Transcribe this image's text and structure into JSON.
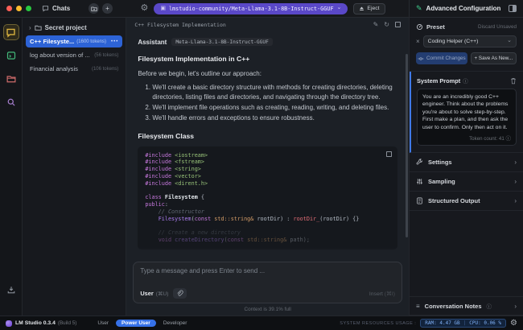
{
  "icons": {
    "gear": "⚙",
    "chevron_down": "⌄",
    "chevron_right": "›",
    "close": "×",
    "plus": "+",
    "dots": "•••",
    "info": "ⓘ",
    "pencil": "✎",
    "regen": "↻",
    "chip": "▣",
    "notes": "≡"
  },
  "topbar": {
    "model_pill": "lmstudio-community/Meta-Llama-3.1-8B-Instruct-GGUF",
    "eject_label": "Eject"
  },
  "sidebar": {
    "title": "Chats",
    "folder_label": "Secret project",
    "chats": [
      {
        "title": "C++ Filesyste...",
        "tokens": "(1600 tokens)"
      },
      {
        "title": "log about version of ...",
        "tokens": "(56 tokens)"
      },
      {
        "title": "Financial analysis",
        "tokens": "(106 tokens)"
      }
    ]
  },
  "chat": {
    "title": "C++ Filesystem Implementation",
    "message": {
      "role": "Assistant",
      "model_badge": "Meta-Llama-3.1-8B-Instruct-GGUF",
      "heading_main": "Filesystem Implementation in C++",
      "intro": "Before we begin, let's outline our approach:",
      "list": [
        "We'll create a basic directory structure with methods for creating directories, deleting directories, listing files and directories, and navigating through the directory tree.",
        "We'll implement file operations such as creating, reading, writing, and deleting files.",
        "We'll handle errors and exceptions to ensure robustness."
      ],
      "heading_code": "Filesystem Class",
      "code": {
        "lines": [
          {
            "segments": [
              {
                "t": "#include ",
                "c": "kw"
              },
              {
                "t": "<iostream>",
                "c": "str"
              }
            ]
          },
          {
            "segments": [
              {
                "t": "#include ",
                "c": "kw"
              },
              {
                "t": "<fstream>",
                "c": "str"
              }
            ]
          },
          {
            "segments": [
              {
                "t": "#include ",
                "c": "kw"
              },
              {
                "t": "<string>",
                "c": "str"
              }
            ]
          },
          {
            "segments": [
              {
                "t": "#include ",
                "c": "kw"
              },
              {
                "t": "<vector>",
                "c": "str"
              }
            ]
          },
          {
            "segments": [
              {
                "t": "#include ",
                "c": "kw"
              },
              {
                "t": "<dirent.h>",
                "c": "str"
              }
            ]
          },
          {
            "segments": []
          },
          {
            "segments": [
              {
                "t": "class ",
                "c": "kw"
              },
              {
                "t": "Filesystem",
                "c": "fnb"
              },
              {
                "t": " {",
                "c": "pl"
              }
            ]
          },
          {
            "segments": [
              {
                "t": "public",
                "c": "kw"
              },
              {
                "t": ":",
                "c": "pl"
              }
            ]
          },
          {
            "segments": [
              {
                "t": "    ",
                "c": "pl"
              },
              {
                "t": "// Constructor",
                "c": "cm"
              }
            ]
          },
          {
            "segments": [
              {
                "t": "    ",
                "c": "pl"
              },
              {
                "t": "Filesystem",
                "c": "pu"
              },
              {
                "t": "(",
                "c": "pl"
              },
              {
                "t": "const",
                "c": "kw"
              },
              {
                "t": " std::string&",
                "c": "ty"
              },
              {
                "t": " rootDir) : ",
                "c": "pl"
              },
              {
                "t": "rootDir_",
                "c": "va"
              },
              {
                "t": "(rootDir) {}",
                "c": "pl"
              }
            ]
          },
          {
            "segments": []
          },
          {
            "faded": true,
            "segments": [
              {
                "t": "    ",
                "c": "pl"
              },
              {
                "t": "// Create a new directory",
                "c": "cm"
              }
            ]
          },
          {
            "faded": true,
            "segments": [
              {
                "t": "    ",
                "c": "pl"
              },
              {
                "t": "void ",
                "c": "kw"
              },
              {
                "t": "createDirectory",
                "c": "pu"
              },
              {
                "t": "(",
                "c": "pl"
              },
              {
                "t": "const",
                "c": "kw"
              },
              {
                "t": " std::string&",
                "c": "ty"
              },
              {
                "t": " path);",
                "c": "pl"
              }
            ]
          }
        ]
      }
    },
    "input": {
      "placeholder": "Type a message and press Enter to send ...",
      "role_label": "User",
      "role_shortcut": "(⌘U)",
      "insert_label": "Insert",
      "insert_shortcut": "(⌘I)"
    },
    "context_status": "Context is 39.1% full"
  },
  "right_panel": {
    "title": "Advanced Configuration",
    "preset": {
      "label": "Preset",
      "discard_label": "Discard Unsaved",
      "selected": "Coding Helper (C++)",
      "commit_label": "Commit Changes",
      "save_as_label": "+ Save As New..."
    },
    "system_prompt": {
      "label": "System Prompt",
      "text": "You are an incredibly good C++ engineer. Think about the problems you're about to solve step-by-step. First make a plan, and then ask the user to confirm. Only then act on it.",
      "token_count": "Token count: 41"
    },
    "sections": [
      {
        "label": "Settings"
      },
      {
        "label": "Sampling"
      },
      {
        "label": "Structured Output"
      }
    ],
    "notes_label": "Conversation Notes"
  },
  "statusbar": {
    "app": "LM Studio 0.3.4",
    "build": "(Build 5)",
    "modes": [
      "User",
      "Power User",
      "Developer"
    ],
    "resources_label": "SYSTEM RESOURCES USAGE :",
    "ram": "RAM: 4.47 GB",
    "sep": "|",
    "cpu": "CPU: 0.06 %"
  },
  "colors": {
    "accent_blue": "#2d63d6",
    "model_purple": "#5a48c8",
    "power_pill_blue": "#3671e8",
    "usage_text_blue": "#7fb0f7",
    "rail_active_yellow": "#d9b23f",
    "config_green": "#3fce8c"
  }
}
